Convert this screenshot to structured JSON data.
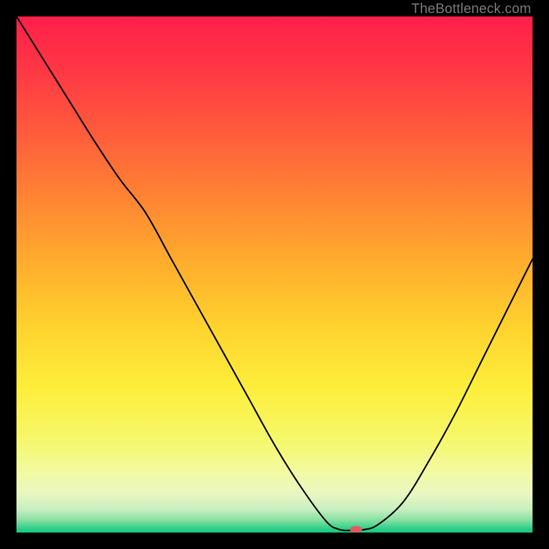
{
  "watermark": "TheBottleneck.com",
  "chart_data": {
    "type": "line",
    "title": "",
    "xlabel": "",
    "ylabel": "",
    "xlim": [
      0,
      100
    ],
    "ylim": [
      0,
      100
    ],
    "grid": false,
    "x": [
      0,
      5,
      10,
      15,
      20,
      25,
      30,
      35,
      40,
      45,
      50,
      55,
      60,
      62.5,
      65,
      67,
      70,
      75,
      80,
      85,
      90,
      95,
      100
    ],
    "values": [
      100,
      92,
      84,
      76,
      68.5,
      62,
      53,
      44,
      35,
      26,
      17,
      9,
      2.2,
      0.6,
      0.4,
      0.5,
      1.5,
      6,
      14,
      23,
      33,
      43,
      53
    ],
    "marker": {
      "x": 65.8,
      "y": 0.6,
      "color": "#e05a5d",
      "rx": 9,
      "ry": 5
    },
    "gradient_stops": [
      {
        "offset": 0.0,
        "color": "#ff1f4a"
      },
      {
        "offset": 0.1,
        "color": "#ff3645"
      },
      {
        "offset": 0.22,
        "color": "#ff5a3c"
      },
      {
        "offset": 0.35,
        "color": "#ff8433"
      },
      {
        "offset": 0.48,
        "color": "#ffae2d"
      },
      {
        "offset": 0.6,
        "color": "#ffd22e"
      },
      {
        "offset": 0.72,
        "color": "#fdee3b"
      },
      {
        "offset": 0.82,
        "color": "#f5f86a"
      },
      {
        "offset": 0.885,
        "color": "#f2faa3"
      },
      {
        "offset": 0.925,
        "color": "#e8f7c1"
      },
      {
        "offset": 0.955,
        "color": "#c8efc0"
      },
      {
        "offset": 0.975,
        "color": "#8be0a4"
      },
      {
        "offset": 0.992,
        "color": "#2fd08a"
      },
      {
        "offset": 1.0,
        "color": "#14c983"
      }
    ]
  }
}
